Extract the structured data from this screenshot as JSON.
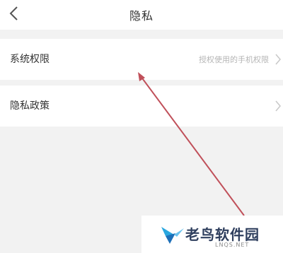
{
  "header": {
    "title": "隐私",
    "back_icon": "chevron-left-icon"
  },
  "settings": {
    "items": [
      {
        "label": "系统权限",
        "value": "授权使用的手机权限",
        "icon": "chevron-right-icon"
      },
      {
        "label": "隐私政策",
        "value": "",
        "icon": "chevron-right-icon"
      }
    ]
  },
  "annotation": {
    "arrow_color": "#c0505a",
    "arrow_target": "系统权限"
  },
  "watermark": {
    "text": "老鸟软件园",
    "sub": "LNQS.NET"
  },
  "colors": {
    "page_background": "#f2f2f2",
    "row_background": "#ffffff",
    "secondary_text": "#b5b5b5"
  }
}
